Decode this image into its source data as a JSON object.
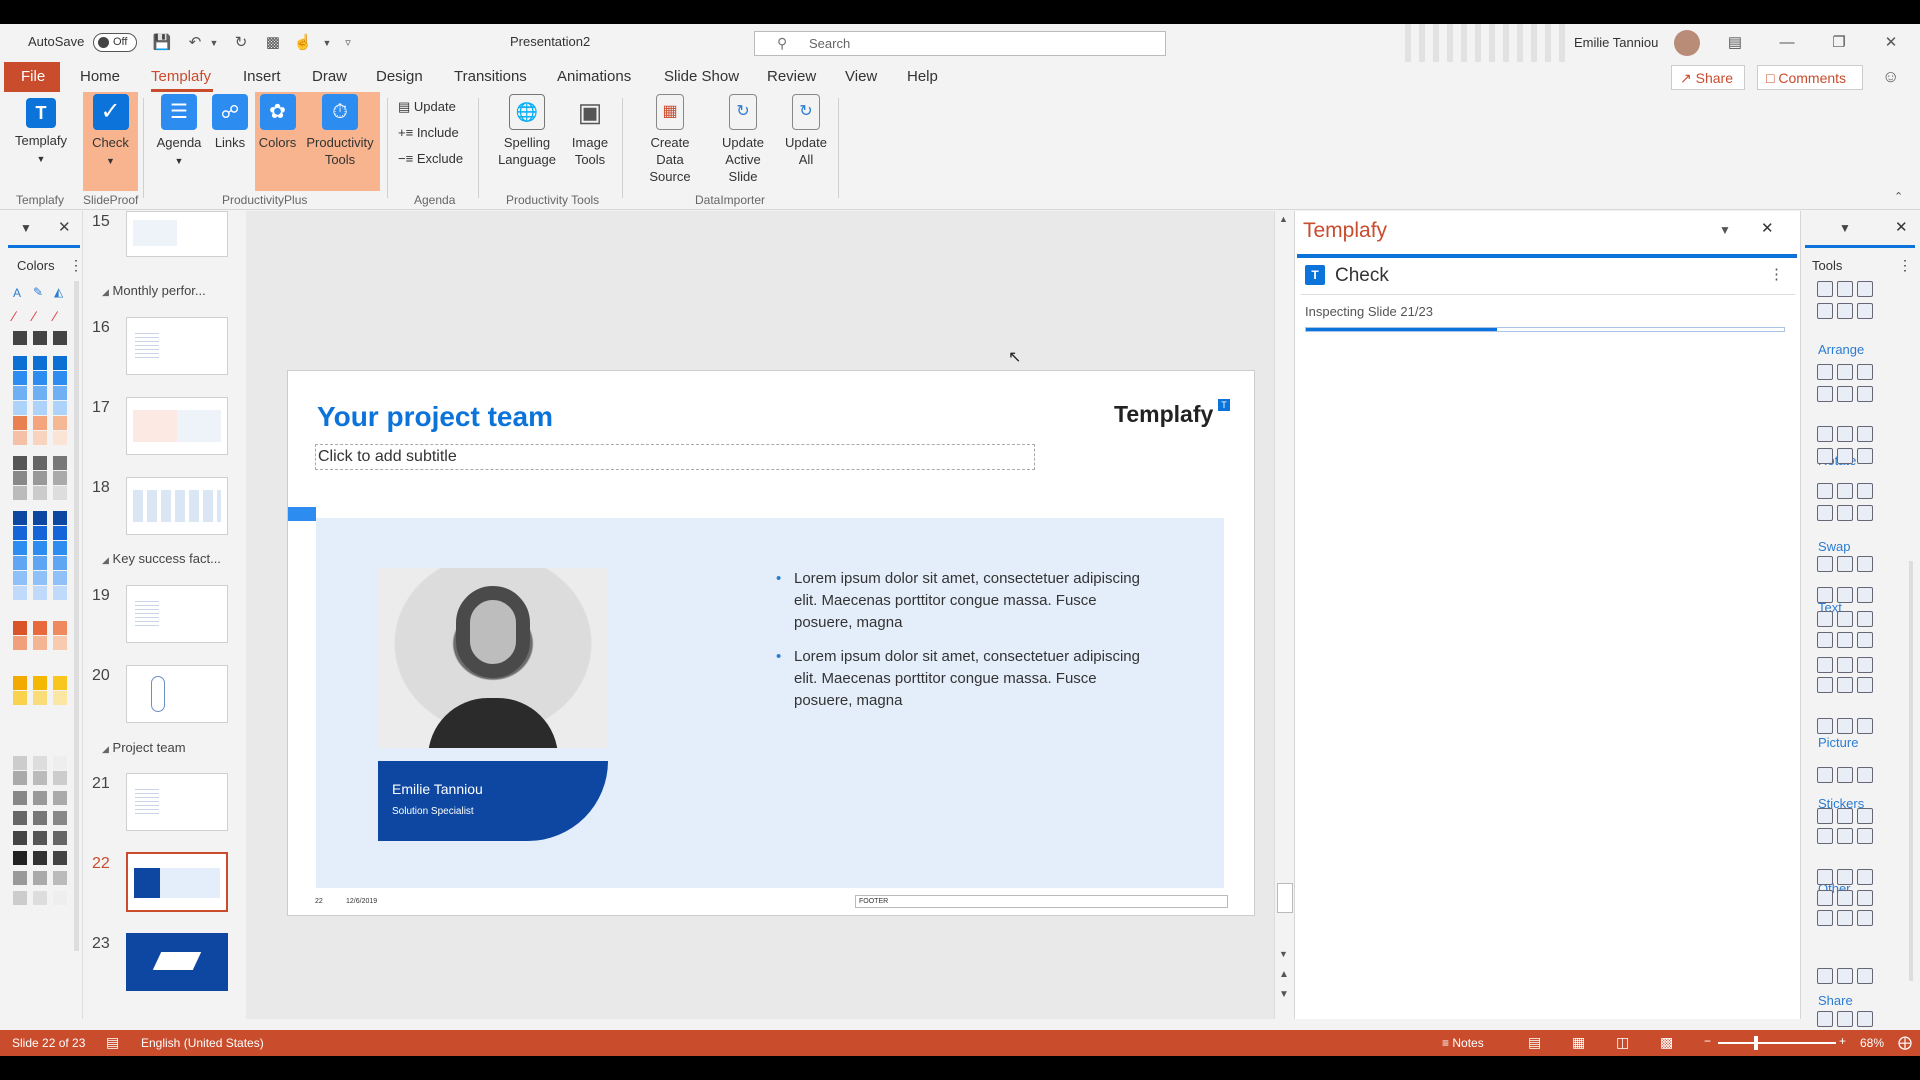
{
  "titlebar": {
    "autosave_label": "AutoSave",
    "autosave_state": "Off",
    "doc_title": "Presentation2",
    "search_placeholder": "Search",
    "user_name": "Emilie Tanniou"
  },
  "menu": {
    "items": [
      "File",
      "Home",
      "Templafy",
      "Insert",
      "Draw",
      "Design",
      "Transitions",
      "Animations",
      "Slide Show",
      "Review",
      "View",
      "Help"
    ],
    "share": "Share",
    "comments": "Comments"
  },
  "ribbon": {
    "templafy": "Templafy",
    "check": "Check",
    "agenda": "Agenda",
    "links": "Links",
    "colors": "Colors",
    "productivity_tools": "Productivity Tools",
    "update": "Update",
    "include": "Include",
    "exclude": "Exclude",
    "spelling_language": "Spelling Language",
    "image_tools": "Image Tools",
    "create_data_source": "Create Data Source",
    "update_active_slide": "Update Active Slide",
    "update_all": "Update All",
    "groups": {
      "templafy": "Templafy",
      "slideproof": "SlideProof",
      "productivityplus": "ProductivityPlus",
      "agenda": "Agenda",
      "productivity_tools": "Productivity Tools",
      "dataimporter": "DataImporter"
    }
  },
  "colors_pane": {
    "title": "Colors"
  },
  "thumbnails": {
    "sections": {
      "monthly": "Monthly perfor...",
      "key": "Key success fact...",
      "project": "Project team"
    },
    "numbers": [
      "15",
      "16",
      "17",
      "18",
      "19",
      "20",
      "21",
      "22",
      "23"
    ]
  },
  "slide": {
    "title": "Your project team",
    "subtitle": "Click to add subtitle",
    "logo": "Templafy",
    "bullets": [
      "Lorem ipsum dolor sit amet, consectetuer adipiscing elit. Maecenas porttitor congue massa. Fusce posuere, magna",
      "Lorem ipsum dolor sit amet, consectetuer adipiscing elit. Maecenas porttitor congue massa. Fusce posuere, magna"
    ],
    "person_name": "Emilie Tanniou",
    "person_role": "Solution Specialist",
    "page_num": "22",
    "date": "12/6/2019",
    "footer": "FOOTER"
  },
  "tpane": {
    "title": "Templafy",
    "check_title": "Check",
    "status": "Inspecting Slide 21/23",
    "progress": 0.4
  },
  "tools": {
    "title": "Tools",
    "categories": [
      "Arrange",
      "Rotate",
      "Swap",
      "Text",
      "Picture",
      "Stickers",
      "Other",
      "Share"
    ]
  },
  "statusbar": {
    "slide": "Slide 22 of 23",
    "language": "English (United States)",
    "notes": "Notes",
    "zoom": "68%"
  },
  "colors": {
    "accent_red": "#c94c2d",
    "templafy_blue": "#0b73d9",
    "navy": "#0d47a1",
    "light_blue": "#e4eefa",
    "highlight_orange": "#f8b48e"
  }
}
